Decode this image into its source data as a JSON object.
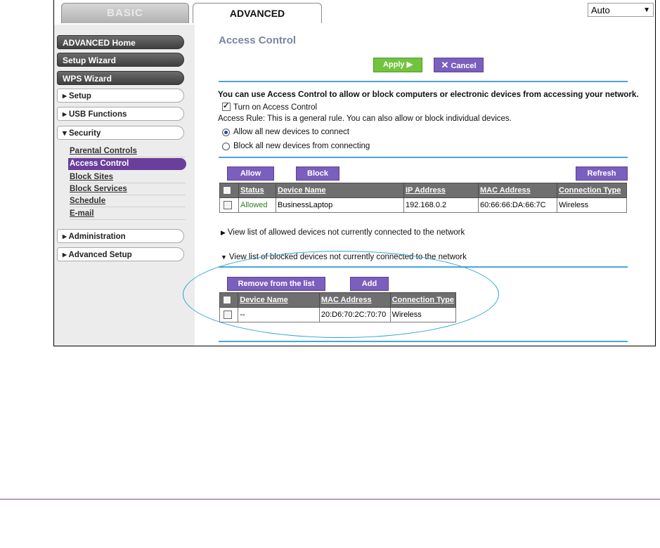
{
  "tabs": {
    "basic": "BASIC",
    "advanced": "ADVANCED"
  },
  "language_select": {
    "value": "Auto"
  },
  "sidebar": {
    "items": [
      {
        "label": "ADVANCED Home"
      },
      {
        "label": "Setup Wizard"
      },
      {
        "label": "WPS Wizard"
      },
      {
        "label": "▸ Setup"
      },
      {
        "label": "▸ USB Functions"
      },
      {
        "label": "▾ Security"
      },
      {
        "label": "▸ Administration"
      },
      {
        "label": "▸ Advanced Setup"
      }
    ],
    "security_sub": [
      {
        "label": "Parental Controls"
      },
      {
        "label": "Access Control"
      },
      {
        "label": "Block Sites"
      },
      {
        "label": "Block Services"
      },
      {
        "label": "Schedule"
      },
      {
        "label": "E-mail"
      }
    ]
  },
  "main": {
    "title": "Access Control",
    "apply_label": "Apply ▶",
    "cancel_label": "Cancel",
    "intro": "You can use Access Control to allow or block computers or electronic devices from accessing your network.",
    "turn_on_label": "Turn on Access Control",
    "turn_on_checked": true,
    "rule_text": "Access Rule: This is a general rule. You can also allow or block individual devices.",
    "rule_options": [
      {
        "label": "Allow all new devices to connect",
        "selected": true
      },
      {
        "label": "Block all new devices from connecting",
        "selected": false
      }
    ],
    "allow_label": "Allow",
    "block_label": "Block",
    "refresh_label": "Refresh",
    "devices_table": {
      "headers": [
        "Status",
        "Device Name",
        "IP Address",
        "MAC Address",
        "Connection Type"
      ],
      "rows": [
        {
          "status": "Allowed",
          "device_name": "BusinessLaptop",
          "ip": "192.168.0.2",
          "mac": "60:66:66:DA:66:7C",
          "connection": "Wireless"
        }
      ]
    },
    "allowed_list_link": "View list of allowed devices not currently connected to the network",
    "blocked_list_link": "View list of blocked devices not currently connected to the network",
    "remove_label": "Remove from the list",
    "add_label": "Add",
    "blocked_table": {
      "headers": [
        "Device Name",
        "MAC Address",
        "Connection Type"
      ],
      "rows": [
        {
          "device_name": "--",
          "mac": "20:D6:70:2C:70:70",
          "connection": "Wireless"
        }
      ]
    }
  },
  "colors": {
    "accent_purple": "#7b5fbd",
    "apply_green": "#72c33e",
    "divider_blue": "#49a6d6",
    "highlight_ellipse": "#2aa3d8"
  }
}
